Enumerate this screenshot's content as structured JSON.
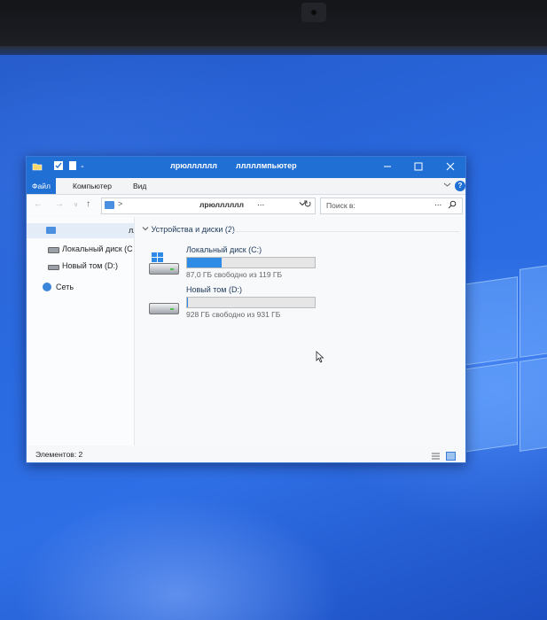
{
  "window": {
    "title_part1": "лрюлллллл",
    "title_part2": "лллллмпьютер",
    "quick_access_dropdown": "-"
  },
  "ribbon": {
    "tabs": [
      {
        "label": "Файл",
        "active": true
      },
      {
        "label": "Компьютер",
        "active": false
      },
      {
        "label": "Вид",
        "active": false
      }
    ],
    "help": "?"
  },
  "navbar": {
    "address_sep": ">",
    "address_text": "лрюлллллл",
    "address_ellipsis": "...",
    "search_placeholder": "Поиск в:",
    "search_ellipsis": "..."
  },
  "nav_pane": {
    "items": [
      {
        "label": "лл",
        "icon": "computer-icon",
        "selected": true
      },
      {
        "label": "Локальный диск (С",
        "icon": "drive-icon"
      },
      {
        "label": "Новый том (D:)",
        "icon": "drive-icon"
      },
      {
        "label": "Сеть",
        "icon": "network-icon"
      }
    ]
  },
  "content": {
    "group_header": "Устройства и диски (2)",
    "drives": [
      {
        "name": "Локальный диск (C:)",
        "free_text": "87,0 ГБ свободно из 119 ГБ",
        "used_fraction": 0.27,
        "has_windows_logo": true
      },
      {
        "name": "Новый том (D:)",
        "free_text": "928 ГБ свободно из 931 ГБ",
        "used_fraction": 0.003,
        "has_windows_logo": false
      }
    ]
  },
  "status": {
    "items_text": "Элементов: 2"
  },
  "colors": {
    "accent": "#1f6fd4",
    "bar_fill": "#2f8ce6",
    "desktop": "#2a6ae0"
  }
}
